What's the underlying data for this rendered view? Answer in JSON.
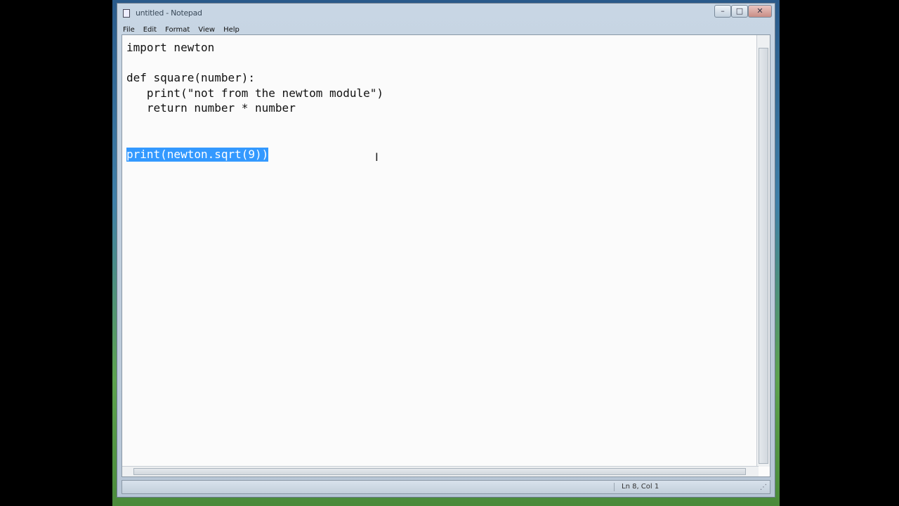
{
  "window": {
    "title": "untitled - Notepad",
    "min_glyph": "–",
    "max_glyph": "□",
    "close_glyph": "✕"
  },
  "menu": [
    "File",
    "Edit",
    "Format",
    "View",
    "Help"
  ],
  "editor": {
    "lines": [
      "import newton",
      "",
      "def square(number):",
      "   print(\"not from the newtom module\")",
      "   return number * number",
      "",
      "",
      "print(newton.sqrt(9))"
    ],
    "selected_line_index": 7,
    "text_cursor_glyph": "I"
  },
  "status": {
    "position": "Ln 8, Col 1",
    "grip": "⋰"
  }
}
